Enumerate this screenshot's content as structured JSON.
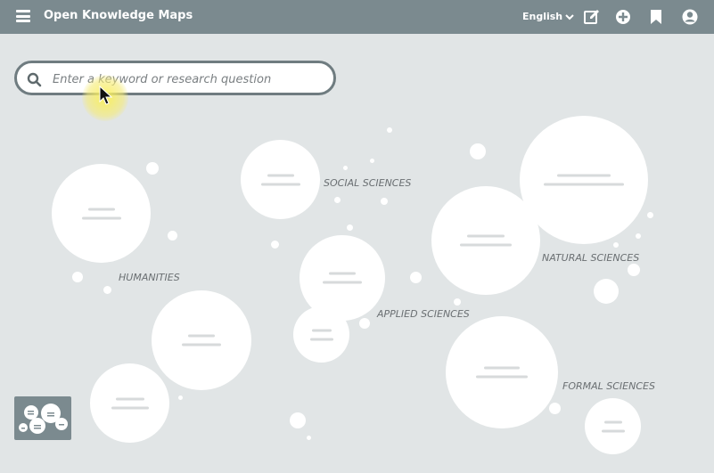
{
  "header": {
    "title": "Open Knowledge Maps",
    "language": "English"
  },
  "icons": {
    "menu": "hamburger-menu-icon",
    "language_chevron": "chevron-down-icon",
    "edit": "edit-icon",
    "add": "plus-circle-icon",
    "bookmark": "bookmark-icon",
    "account": "user-circle-icon",
    "search": "search-icon",
    "cursor": "mouse-pointer-icon"
  },
  "search": {
    "placeholder": "Enter a keyword or research question",
    "value": ""
  },
  "map": {
    "labels": {
      "social_sciences": "SOCIAL SCIENCES",
      "humanities": "HUMANITIES",
      "natural_sciences": "NATURAL SCIENCES",
      "applied_sciences": "APPLIED SCIENCES",
      "formal_sciences": "FORMAL SCIENCES"
    }
  },
  "colors": {
    "topbar": "#7b8a8f",
    "background": "#e1e5e6",
    "bubble": "#ffffff",
    "cursor_highlight": "#f5eb5a"
  }
}
